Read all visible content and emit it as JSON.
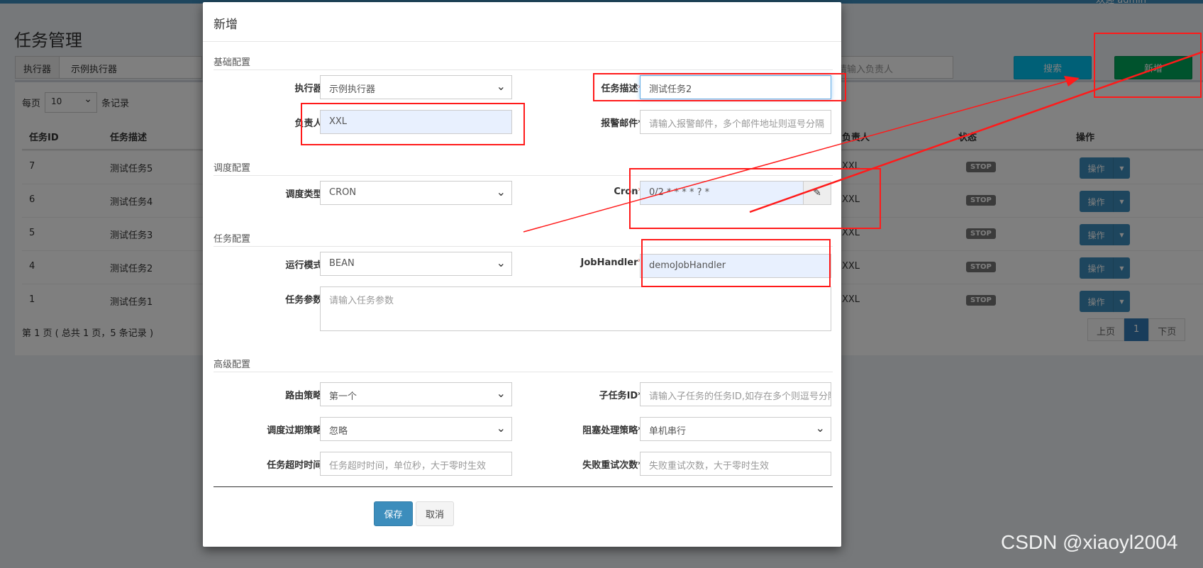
{
  "page": {
    "welcome": "欢迎 admin",
    "title": "任务管理",
    "filter": {
      "label": "执行器",
      "value": "示例执行器"
    },
    "search_owner_placeholder": "请输入负责人",
    "search_label": "搜索",
    "add_label": "新增",
    "pagesize": {
      "prefix": "每页",
      "value": "10",
      "suffix": "条记录"
    },
    "columns": {
      "id": "任务ID",
      "desc": "任务描述",
      "owner": "负责人",
      "status": "状态",
      "ops": "操作"
    },
    "rows": [
      {
        "id": "7",
        "desc": "测试任务5",
        "owner": "XXL",
        "status": "STOP",
        "op": "操作"
      },
      {
        "id": "6",
        "desc": "测试任务4",
        "owner": "XXL",
        "status": "STOP",
        "op": "操作"
      },
      {
        "id": "5",
        "desc": "测试任务3",
        "owner": "XXL",
        "status": "STOP",
        "op": "操作"
      },
      {
        "id": "4",
        "desc": "测试任务2",
        "owner": "XXL",
        "status": "STOP",
        "op": "操作"
      },
      {
        "id": "1",
        "desc": "测试任务1",
        "owner": "XXL",
        "status": "STOP",
        "op": "操作"
      }
    ],
    "pager_info": "第 1 页 ( 总共 1 页，5 条记录 )",
    "pager": {
      "prev": "上页",
      "current": "1",
      "next": "下页"
    }
  },
  "modal": {
    "title": "新增",
    "sections": {
      "basic": "基础配置",
      "schedule": "调度配置",
      "task": "任务配置",
      "advanced": "高级配置"
    },
    "fields": {
      "executor": {
        "label": "执行器",
        "value": "示例执行器"
      },
      "job_desc": {
        "label": "任务描述",
        "value": "测试任务2"
      },
      "author": {
        "label": "负责人",
        "value": "XXL"
      },
      "alarm_email": {
        "label": "报警邮件*",
        "placeholder": "请输入报警邮件，多个邮件地址则逗号分隔"
      },
      "schedule_type": {
        "label": "调度类型",
        "value": "CRON"
      },
      "cron": {
        "label": "Cron",
        "value": "0/2 * * * * ? *"
      },
      "glue_type": {
        "label": "运行模式",
        "value": "BEAN"
      },
      "job_handler": {
        "label": "JobHandler",
        "value": "demoJobHandler"
      },
      "job_param": {
        "label": "任务参数*",
        "placeholder": "请输入任务参数"
      },
      "route": {
        "label": "路由策略*",
        "value": "第一个"
      },
      "child_job": {
        "label": "子任务ID*",
        "placeholder": "请输入子任务的任务ID,如存在多个则逗号分隔"
      },
      "misfire": {
        "label": "调度过期策略*",
        "value": "忽略"
      },
      "block": {
        "label": "阻塞处理策略*",
        "value": "单机串行"
      },
      "timeout": {
        "label": "任务超时时间*",
        "placeholder": "任务超时时间，单位秒，大于零时生效"
      },
      "retry": {
        "label": "失败重试次数*",
        "placeholder": "失败重试次数，大于零时生效"
      }
    },
    "save_label": "保存",
    "cancel_label": "取消"
  },
  "watermark": "CSDN @xiaoyl2004",
  "colors": {
    "primary": "#3c8dbc",
    "success": "#00a65a",
    "info": "#00c0ef",
    "annotation": "#ff1a1a"
  }
}
